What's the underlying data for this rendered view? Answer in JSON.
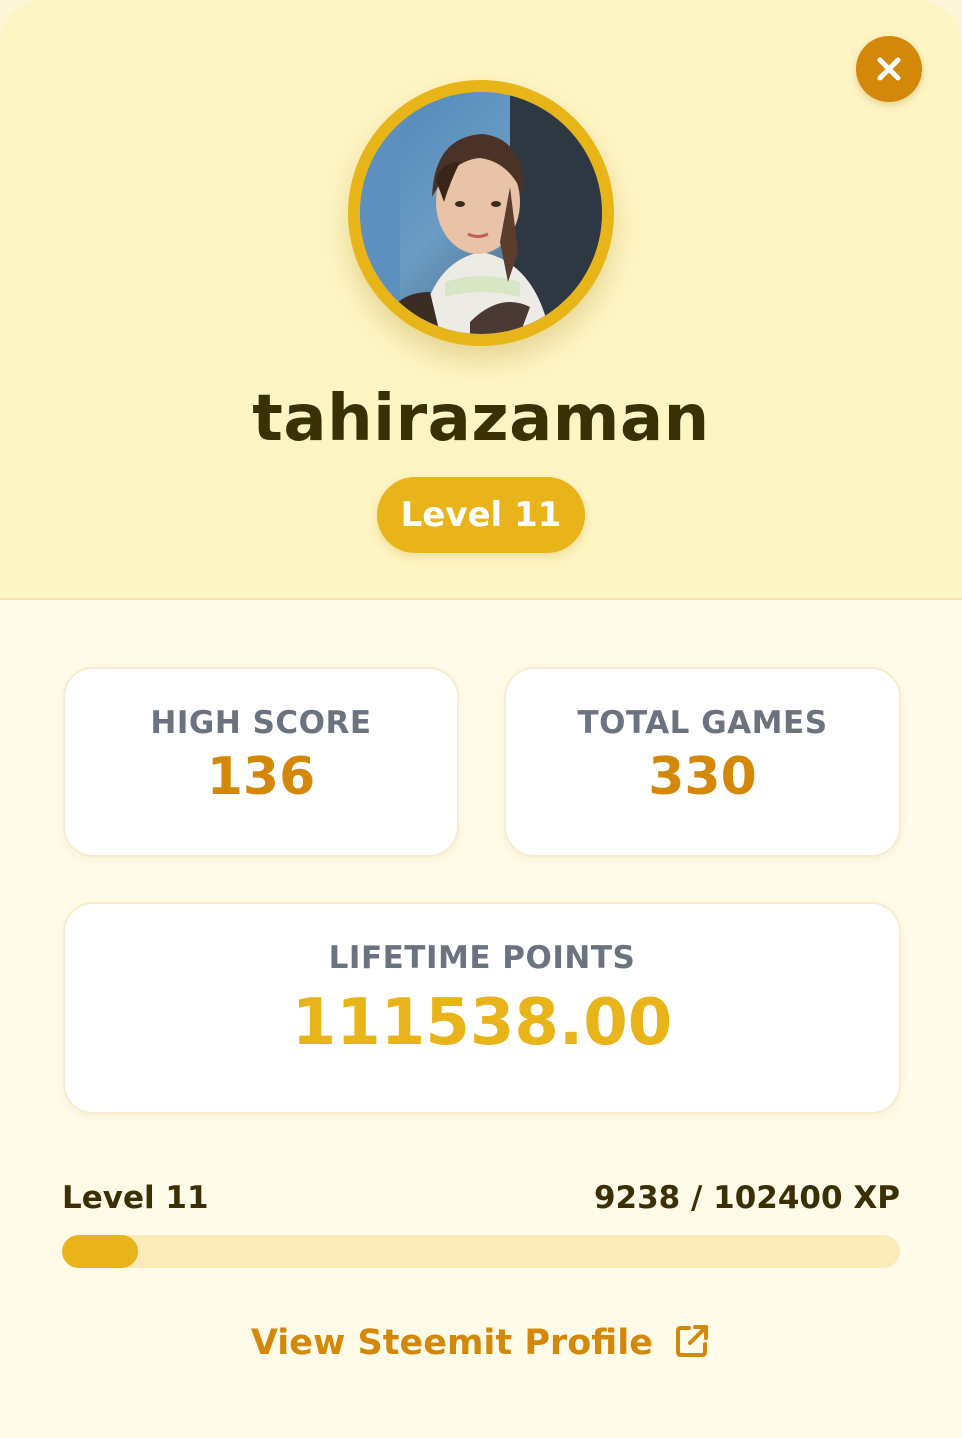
{
  "profile": {
    "username": "tahirazaman",
    "level_badge": "Level 11",
    "avatar_alt": "Profile photo"
  },
  "stats": {
    "high_score": {
      "label": "HIGH SCORE",
      "value": "136"
    },
    "total_games": {
      "label": "TOTAL GAMES",
      "value": "330"
    },
    "lifetime_points": {
      "label": "LIFETIME POINTS",
      "value": "111538.00"
    }
  },
  "progress": {
    "level_label": "Level 11",
    "xp_text": "9238 / 102400 XP",
    "current_xp": 9238,
    "max_xp": 102400
  },
  "actions": {
    "view_profile_label": "View Steemit Profile",
    "close_icon": "close-icon",
    "external_link_icon": "external-link-icon"
  },
  "colors": {
    "accent": "#e9b31a",
    "accent_dark": "#d4880a",
    "header_bg": "#fef5c4",
    "body_bg": "#fffbe9",
    "text_dark": "#3b2f05",
    "label_gray": "#6b7280"
  }
}
